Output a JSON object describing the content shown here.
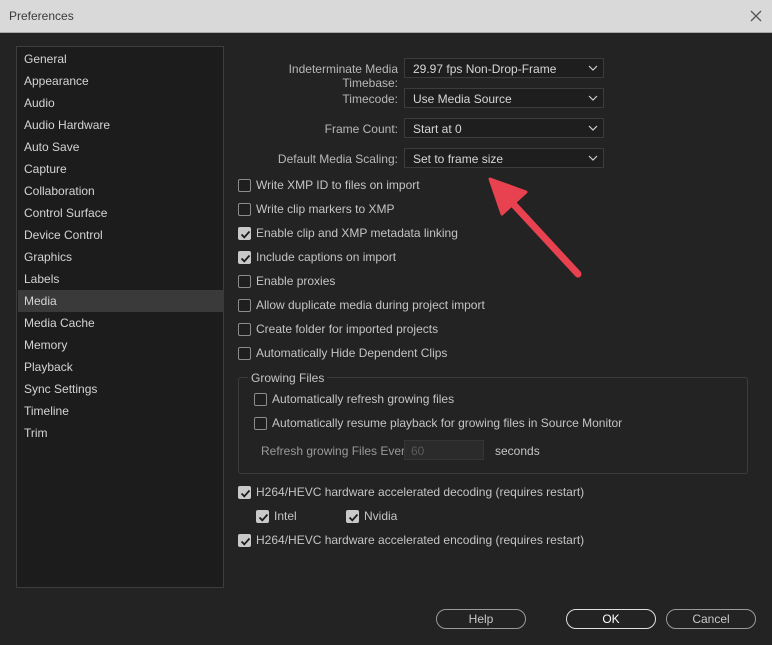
{
  "window": {
    "title": "Preferences"
  },
  "sidebar": {
    "items": [
      {
        "label": "General"
      },
      {
        "label": "Appearance"
      },
      {
        "label": "Audio"
      },
      {
        "label": "Audio Hardware"
      },
      {
        "label": "Auto Save"
      },
      {
        "label": "Capture"
      },
      {
        "label": "Collaboration"
      },
      {
        "label": "Control Surface"
      },
      {
        "label": "Device Control"
      },
      {
        "label": "Graphics"
      },
      {
        "label": "Labels"
      },
      {
        "label": "Media"
      },
      {
        "label": "Media Cache"
      },
      {
        "label": "Memory"
      },
      {
        "label": "Playback"
      },
      {
        "label": "Sync Settings"
      },
      {
        "label": "Timeline"
      },
      {
        "label": "Trim"
      }
    ],
    "selected": "Media"
  },
  "fields": {
    "timebase": {
      "label": "Indeterminate Media Timebase:",
      "value": "29.97 fps Non-Drop-Frame"
    },
    "timecode": {
      "label": "Timecode:",
      "value": "Use Media Source"
    },
    "frame_count": {
      "label": "Frame Count:",
      "value": "Start at 0"
    },
    "scaling": {
      "label": "Default Media Scaling:",
      "value": "Set to frame size"
    }
  },
  "checks": {
    "write_xmp": {
      "label": "Write XMP ID to files on import",
      "checked": false
    },
    "clip_markers": {
      "label": "Write clip markers to XMP",
      "checked": false
    },
    "metadata_linking": {
      "label": "Enable clip and XMP metadata linking",
      "checked": true
    },
    "captions": {
      "label": "Include captions on import",
      "checked": true
    },
    "proxies": {
      "label": "Enable proxies",
      "checked": false
    },
    "duplicate_media": {
      "label": "Allow duplicate media during project import",
      "checked": false
    },
    "create_folder": {
      "label": "Create folder for imported projects",
      "checked": false
    },
    "hide_dependent": {
      "label": "Automatically Hide Dependent Clips",
      "checked": false
    },
    "refresh_growing": {
      "label": "Automatically refresh growing files",
      "checked": false
    },
    "resume_playback": {
      "label": "Automatically resume playback for growing files in Source Monitor",
      "checked": false
    },
    "hw_decoding": {
      "label": "H264/HEVC hardware accelerated decoding (requires restart)",
      "checked": true
    },
    "intel": {
      "label": "Intel",
      "checked": true
    },
    "nvidia": {
      "label": "Nvidia",
      "checked": true
    },
    "hw_encoding": {
      "label": "H264/HEVC hardware accelerated encoding (requires restart)",
      "checked": true
    }
  },
  "growing_files": {
    "title": "Growing Files",
    "refresh_label": "Refresh growing Files Every",
    "refresh_value": "60",
    "unit": "seconds"
  },
  "buttons": {
    "help": "Help",
    "ok": "OK",
    "cancel": "Cancel"
  },
  "colors": {
    "annotation_arrow": "#e8414f",
    "selected_item": "#3a3a3a"
  }
}
